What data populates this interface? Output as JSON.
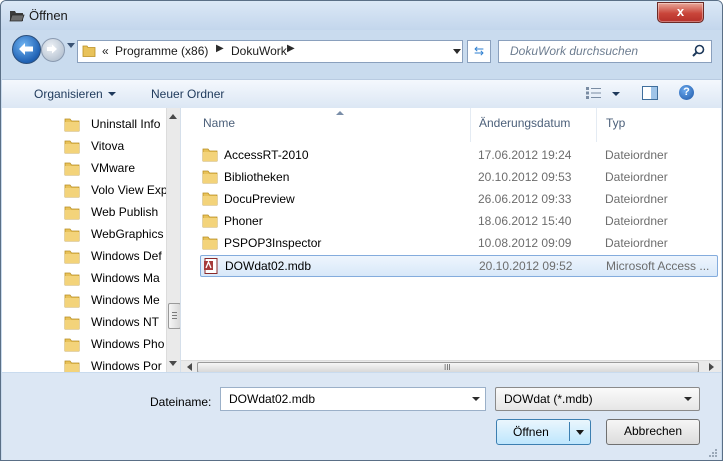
{
  "title": "Öffnen",
  "address": {
    "overflow": "«",
    "segments": [
      "Programme (x86)",
      "DokuWork"
    ]
  },
  "search": {
    "placeholder": "DokuWork durchsuchen"
  },
  "toolbar": {
    "organize": "Organisieren",
    "new_folder": "Neuer Ordner"
  },
  "nav_items": [
    "Uninstall Info",
    "Vitova",
    "VMware",
    "Volo View Exp",
    "Web Publish",
    "WebGraphics",
    "Windows Def",
    "Windows Ma",
    "Windows Me",
    "Windows NT",
    "Windows Pho",
    "Windows Por"
  ],
  "columns": {
    "name": "Name",
    "date": "Änderungsdatum",
    "type": "Typ"
  },
  "files": [
    {
      "name": "AccessRT-2010",
      "date": "17.06.2012 19:24",
      "type": "Dateiordner",
      "icon": "folder-icon"
    },
    {
      "name": "Bibliotheken",
      "date": "20.10.2012 09:53",
      "type": "Dateiordner",
      "icon": "folder-icon"
    },
    {
      "name": "DocuPreview",
      "date": "26.06.2012 09:33",
      "type": "Dateiordner",
      "icon": "folder-icon"
    },
    {
      "name": "Phoner",
      "date": "18.06.2012 15:40",
      "type": "Dateiordner",
      "icon": "folder-icon"
    },
    {
      "name": "PSPOP3Inspector",
      "date": "10.08.2012 09:09",
      "type": "Dateiordner",
      "icon": "folder-icon"
    },
    {
      "name": "DOWdat02.mdb",
      "date": "20.10.2012 09:52",
      "type": "Microsoft Access ...",
      "icon": "access-file-icon",
      "selected": true
    }
  ],
  "filename": {
    "label": "Dateiname:",
    "value": "DOWdat02.mdb"
  },
  "filetype": {
    "value": "DOWdat (*.mdb)"
  },
  "buttons": {
    "open": "Öffnen",
    "cancel": "Abbrechen",
    "close": "x"
  },
  "hscroll_grip": "III",
  "colors": {
    "window_frame": "#c9dbee",
    "selection": "#d8e8f9",
    "selection_border": "#84acdd",
    "close_button": "#c9453a",
    "folder": "#e8c25a"
  }
}
